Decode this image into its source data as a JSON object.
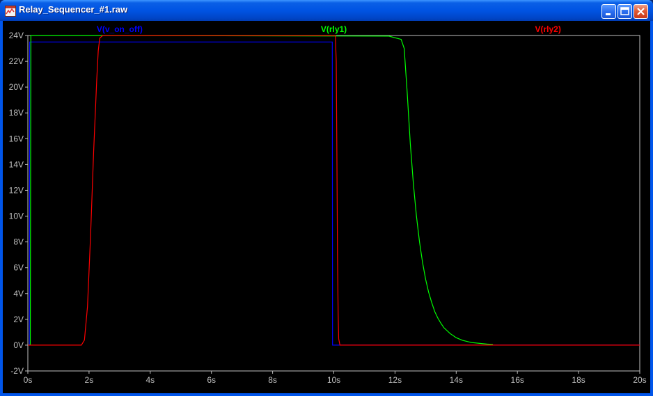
{
  "window": {
    "title": "Relay_Sequencer_#1.raw",
    "minimize_icon": "minimize-icon",
    "maximize_icon": "maximize-icon",
    "close_icon": "close-icon",
    "app_icon": "waveform-icon"
  },
  "chart_data": {
    "type": "line",
    "x_unit": "s",
    "y_unit": "V",
    "xlim": [
      0,
      20
    ],
    "ylim": [
      -2,
      24
    ],
    "x_ticks": [
      "0s",
      "2s",
      "4s",
      "6s",
      "8s",
      "10s",
      "12s",
      "14s",
      "16s",
      "18s",
      "20s"
    ],
    "y_ticks": [
      "-2V",
      "0V",
      "2V",
      "4V",
      "6V",
      "8V",
      "10V",
      "12V",
      "14V",
      "16V",
      "18V",
      "20V",
      "22V",
      "24V"
    ],
    "x_tick_values": [
      0,
      2,
      4,
      6,
      8,
      10,
      12,
      14,
      16,
      18,
      20
    ],
    "y_tick_values": [
      -2,
      0,
      2,
      4,
      6,
      8,
      10,
      12,
      14,
      16,
      18,
      20,
      22,
      24
    ],
    "background": "#000000",
    "axis_color": "#c0c0c0",
    "series": [
      {
        "name": "V(v_on_off)",
        "color": "#0000ff",
        "x": [
          0,
          0.05,
          0.06,
          9.95,
          9.96,
          20
        ],
        "y": [
          0,
          0,
          23.5,
          23.5,
          0,
          0
        ]
      },
      {
        "name": "V(rly1)",
        "color": "#00ff00",
        "x": [
          0,
          0.08,
          0.1,
          2.0,
          11.8,
          12.2,
          12.3,
          12.4,
          12.5,
          12.6,
          12.7,
          12.8,
          12.9,
          13.0,
          13.1,
          13.2,
          13.3,
          13.4,
          13.5,
          13.6,
          13.8,
          14.0,
          14.2,
          14.5,
          15.0,
          15.2
        ],
        "y": [
          0,
          0,
          24.0,
          24.0,
          23.95,
          23.7,
          23.0,
          19.5,
          15.6,
          12.5,
          10.0,
          8.0,
          6.4,
          5.1,
          4.1,
          3.3,
          2.6,
          2.1,
          1.7,
          1.35,
          0.9,
          0.58,
          0.38,
          0.2,
          0.08,
          0.05
        ]
      },
      {
        "name": "V(rly2)",
        "color": "#ff0000",
        "x": [
          0,
          1.75,
          1.85,
          1.95,
          2.05,
          2.15,
          2.25,
          2.3,
          2.35,
          2.45,
          10.05,
          10.08,
          10.1,
          10.12,
          10.14,
          10.16,
          10.2,
          20
        ],
        "y": [
          0,
          0,
          0.4,
          3.0,
          8.5,
          15.0,
          20.5,
          22.8,
          23.8,
          24.0,
          24.0,
          22.0,
          15.0,
          7.0,
          2.5,
          0.5,
          0,
          0
        ]
      }
    ]
  }
}
